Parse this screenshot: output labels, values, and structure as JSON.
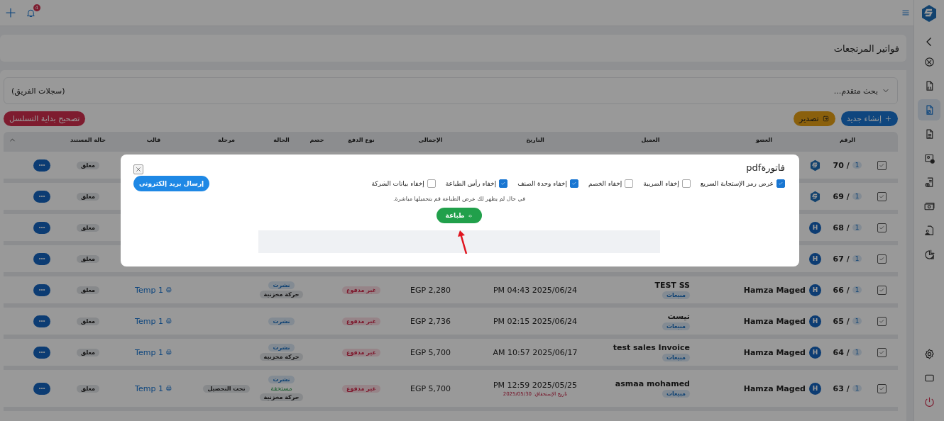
{
  "topbar": {
    "notification_count": "4"
  },
  "sidebar": {
    "items": [
      {
        "selected": false
      },
      {
        "selected": false
      },
      {
        "selected": true
      },
      {
        "selected": false
      },
      {
        "selected": false
      },
      {
        "selected": false
      },
      {
        "selected": false
      },
      {
        "selected": false
      },
      {
        "selected": false
      }
    ]
  },
  "page_title": "فواتير المرتجعات",
  "search": {
    "label": "بحث متقدم...",
    "scope": "(سجلات الفريق)"
  },
  "actions": [
    {
      "label": "إنشاء جديد",
      "kind": "create"
    },
    {
      "label": "تصدير",
      "kind": "export"
    }
  ],
  "reset_button": "تصحيح بداية التسلسل",
  "table": {
    "columns": [
      "الرقم",
      "العضو",
      "العميل",
      "التاريخ",
      "الإجمالي",
      "نوع الدفع",
      "خصم",
      "الحالة",
      "مرحلة",
      "قالب",
      "حالة المستند"
    ],
    "rows": [
      {
        "checked": true,
        "number": "70 /",
        "sequence": "1",
        "avatar": {
          "kind": "logo"
        },
        "doc_status": "معلق"
      },
      {
        "checked": true,
        "number": "69 /",
        "sequence": "1",
        "avatar": {
          "kind": "logo"
        },
        "doc_status": "معلق"
      },
      {
        "checked": true,
        "number": "68 /",
        "sequence": "1",
        "avatar": {
          "kind": "letter",
          "letter": "H"
        },
        "doc_status": "معلق"
      },
      {
        "checked": true,
        "number": "67 /",
        "sequence": "1",
        "avatar": {
          "kind": "letter",
          "letter": "H"
        },
        "doc_status": "معلق"
      },
      {
        "checked": true,
        "number": "66 /",
        "sequence": "1",
        "avatar": {
          "kind": "letter",
          "letter": "H"
        },
        "member": "Hamza Maged",
        "client": "TEST SS",
        "client_tag": "مبيعات",
        "date": "PM 04:43 2025/06/24",
        "total": "EGP 2,280",
        "payment": "غير مدفوع",
        "statuses": [
          {
            "kind": "published",
            "text": "نشرت"
          },
          {
            "kind": "stock",
            "text": "حركة مخزنية"
          }
        ],
        "template": "Temp 1",
        "doc_status": "معلق"
      },
      {
        "checked": true,
        "number": "65 /",
        "sequence": "1",
        "avatar": {
          "kind": "letter",
          "letter": "H"
        },
        "member": "Hamza Maged",
        "client": "تيست",
        "client_tag": "مبيعات",
        "date": "PM 02:15 2025/06/24",
        "total": "EGP 2,736",
        "payment": "غير مدفوع",
        "statuses": [
          {
            "kind": "published",
            "text": "نشرت"
          }
        ],
        "template": "Temp 1",
        "doc_status": "معلق"
      },
      {
        "checked": true,
        "number": "64 /",
        "sequence": "1",
        "avatar": {
          "kind": "letter",
          "letter": "H"
        },
        "member": "Hamza Maged",
        "client": "test sales Invoice",
        "client_tag": "مبيعات",
        "date": "AM 10:57 2025/06/17",
        "total": "EGP 5,700",
        "payment": "غير مدفوع",
        "statuses": [
          {
            "kind": "published",
            "text": "نشرت"
          },
          {
            "kind": "stock",
            "text": "حركة مخزنية"
          }
        ],
        "template": "Temp 1",
        "doc_status": "معلق"
      },
      {
        "checked": true,
        "number": "63 /",
        "sequence": "1",
        "avatar": {
          "kind": "letter",
          "letter": "H"
        },
        "member": "Hamza Maged",
        "client": "asmaa mohamed",
        "client_tag": "مبيعات",
        "date": "PM 12:59 2025/05/25",
        "due": "تاريخ الإستحقاق: 2025/05/30",
        "total": "EGP 5,700",
        "payment": "غير مدفوع",
        "statuses": [
          {
            "kind": "published",
            "text": "نشرت"
          },
          {
            "kind": "due",
            "text": "مستحقة"
          },
          {
            "kind": "stock",
            "text": "حركة مخزنية"
          }
        ],
        "stage": "تحت التحصيل",
        "template": "Temp 1",
        "doc_status": "معلق"
      }
    ]
  },
  "modal": {
    "title": "فاتورةpdf",
    "options": [
      {
        "label": "عرض رمز الإستجابة السريع",
        "checked": true
      },
      {
        "label": "إخفاء الضريبة",
        "checked": false
      },
      {
        "label": "إخفاء الخصم",
        "checked": false
      },
      {
        "label": "إخفاء وحدة الصنف",
        "checked": true
      },
      {
        "label": "إخفاء رأس الطباعة",
        "checked": true
      },
      {
        "label": "إخفاء بيانات الشركة",
        "checked": false
      }
    ],
    "email_button": "إرسال بريد إلكترونى",
    "note": "في حال لم يظهر لك عرض الطباعة قم بتحميلها مباشرة.",
    "print_button": "طباعة"
  }
}
